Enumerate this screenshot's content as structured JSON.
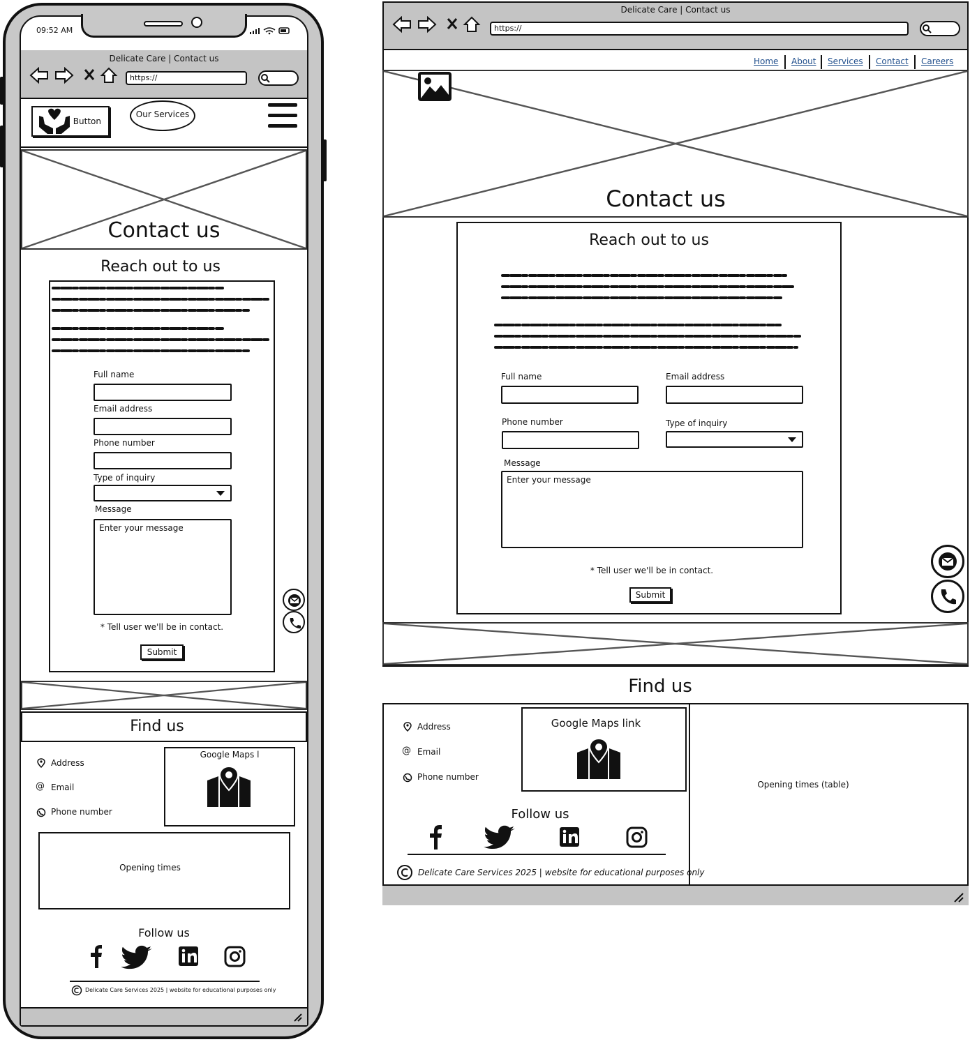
{
  "mobile": {
    "status_bar": {
      "time": "09:52 AM"
    },
    "browser": {
      "title": "Delicate Care | Contact us",
      "url": "https://"
    },
    "header": {
      "logo_button_label": "Button",
      "services_button_label": "Our Services"
    },
    "hero": {
      "title": "Contact us"
    },
    "form_section": {
      "heading": "Reach out to us",
      "fields": {
        "full_name": "Full name",
        "email": "Email address",
        "phone": "Phone number",
        "inquiry": "Type of inquiry",
        "message": "Message",
        "message_placeholder": "Enter your message"
      },
      "note": "* Tell user we'll be in contact.",
      "submit_label": "Submit"
    },
    "find_us": {
      "heading": "Find us",
      "address": "Address",
      "email": "Email",
      "phone": "Phone number",
      "maps_label": "Google Maps l",
      "opening_times": "Opening times"
    },
    "follow": {
      "heading": "Follow us"
    },
    "footer": {
      "copyright": "Delicate Care Services 2025 | website for educational purposes only"
    }
  },
  "desktop": {
    "browser": {
      "title": "Delicate Care | Contact us",
      "url": "https://"
    },
    "nav": {
      "items": [
        "Home",
        "About",
        "Services",
        "Contact",
        "Careers"
      ],
      "link_color": "#1f4e8c"
    },
    "hero": {
      "title": "Contact us"
    },
    "form_section": {
      "heading": "Reach out to us",
      "fields": {
        "full_name": "Full name",
        "email": "Email address",
        "phone": "Phone number",
        "inquiry": "Type of inquiry",
        "message": "Message",
        "message_placeholder": "Enter your message"
      },
      "note": "* Tell user we'll be in contact.",
      "submit_label": "Submit"
    },
    "find_us": {
      "heading": "Find us",
      "address": "Address",
      "email": "Email",
      "phone": "Phone number",
      "maps_label": "Google Maps link",
      "opening_times": "Opening times (table)"
    },
    "follow": {
      "heading": "Follow us"
    },
    "footer": {
      "copyright": "Delicate Care Services 2025 | website for educational purposes only"
    }
  },
  "icons": {
    "mobile_header": [
      "heart-hands-icon",
      "hamburger-menu-icon"
    ],
    "floating": [
      "email-icon",
      "phone-icon"
    ],
    "social": [
      "facebook-icon",
      "twitter-icon",
      "linkedin-icon",
      "instagram-icon"
    ],
    "contact": [
      "location-pin-icon",
      "at-icon",
      "phone-small-icon",
      "map-icon",
      "copyright-icon"
    ],
    "browser": [
      "back-arrow-icon",
      "forward-arrow-icon",
      "stop-icon",
      "home-icon",
      "search-icon"
    ]
  }
}
